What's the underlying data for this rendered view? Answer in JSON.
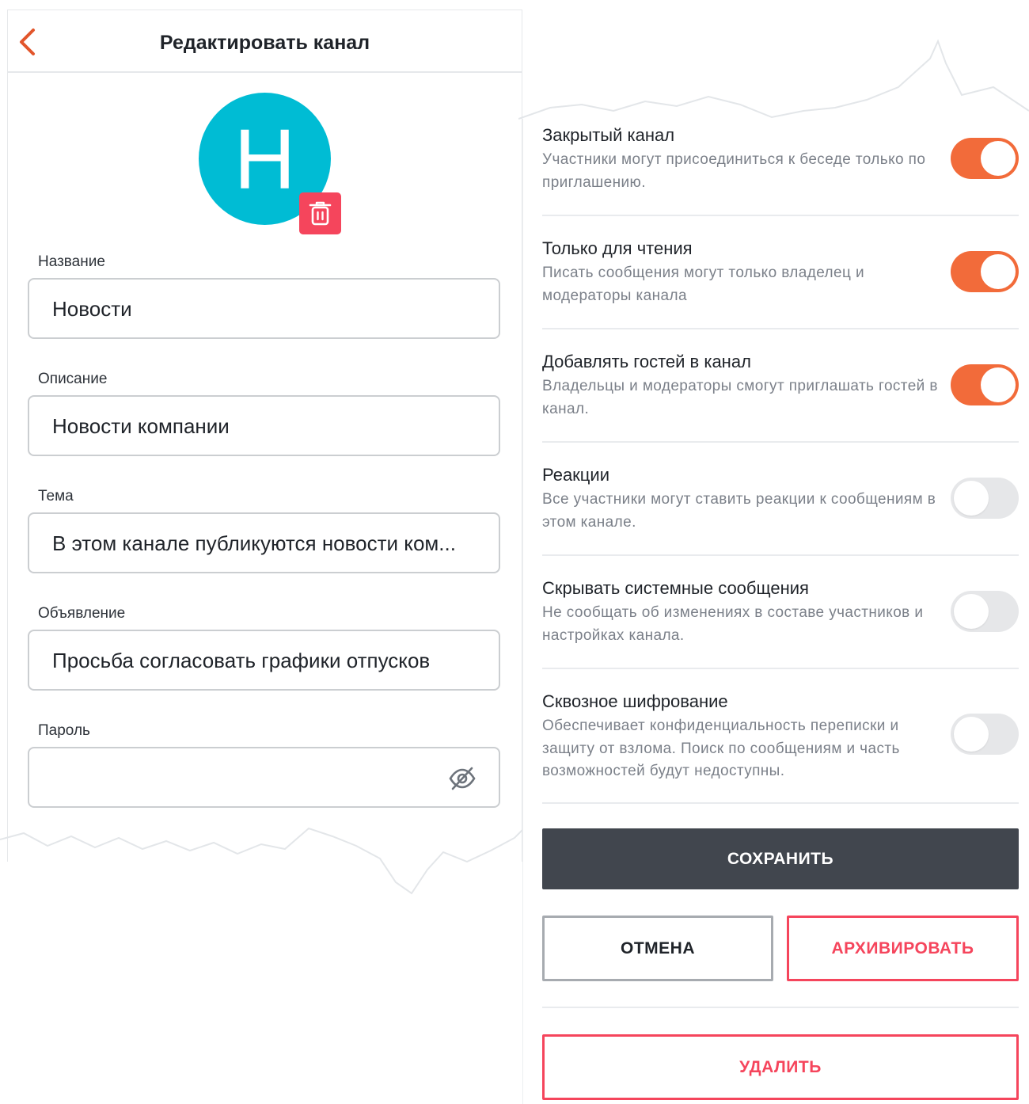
{
  "header": {
    "title": "Редактировать канал"
  },
  "avatar": {
    "letter": "Н",
    "color": "#00bcd4"
  },
  "fields": [
    {
      "label": "Название",
      "value": "Новости"
    },
    {
      "label": "Описание",
      "value": "Новости компании"
    },
    {
      "label": "Тема",
      "value": "В этом канале публикуются новости ком..."
    },
    {
      "label": "Объявление",
      "value": "Просьба согласовать графики отпусков"
    },
    {
      "label": "Пароль",
      "value": ""
    }
  ],
  "settings": [
    {
      "title": "Закрытый канал",
      "description": "Участники могут присоединиться к беседе только по приглашению.",
      "enabled": true
    },
    {
      "title": "Только для чтения",
      "description": "Писать сообщения могут только владелец и модераторы канала",
      "enabled": true
    },
    {
      "title": "Добавлять гостей в канал",
      "description": "Владельцы и модераторы смогут приглашать гостей в канал.",
      "enabled": true
    },
    {
      "title": "Реакции",
      "description": "Все участники могут ставить реакции к сообщениям в этом канале.",
      "enabled": false
    },
    {
      "title": "Скрывать системные сообщения",
      "description": "Не сообщать об изменениях в составе участников и настройках канала.",
      "enabled": false
    },
    {
      "title": "Сквозное шифрование",
      "description": "Обеспечивает конфиденциальность переписки и защиту от взлома. Поиск по сообщениям и часть возможностей будут недоступны.",
      "enabled": false
    }
  ],
  "buttons": {
    "save": "СОХРАНИТЬ",
    "cancel": "ОТМЕНА",
    "archive": "АРХИВИРОВАТЬ",
    "delete": "УДАЛИТЬ"
  },
  "colors": {
    "accent": "#f26b3a",
    "danger": "#f5455c",
    "dark_button": "#41464e"
  },
  "icons": {
    "back": "chevron-left-icon",
    "delete_avatar": "trash-icon",
    "password_visibility": "eye-off-icon"
  }
}
